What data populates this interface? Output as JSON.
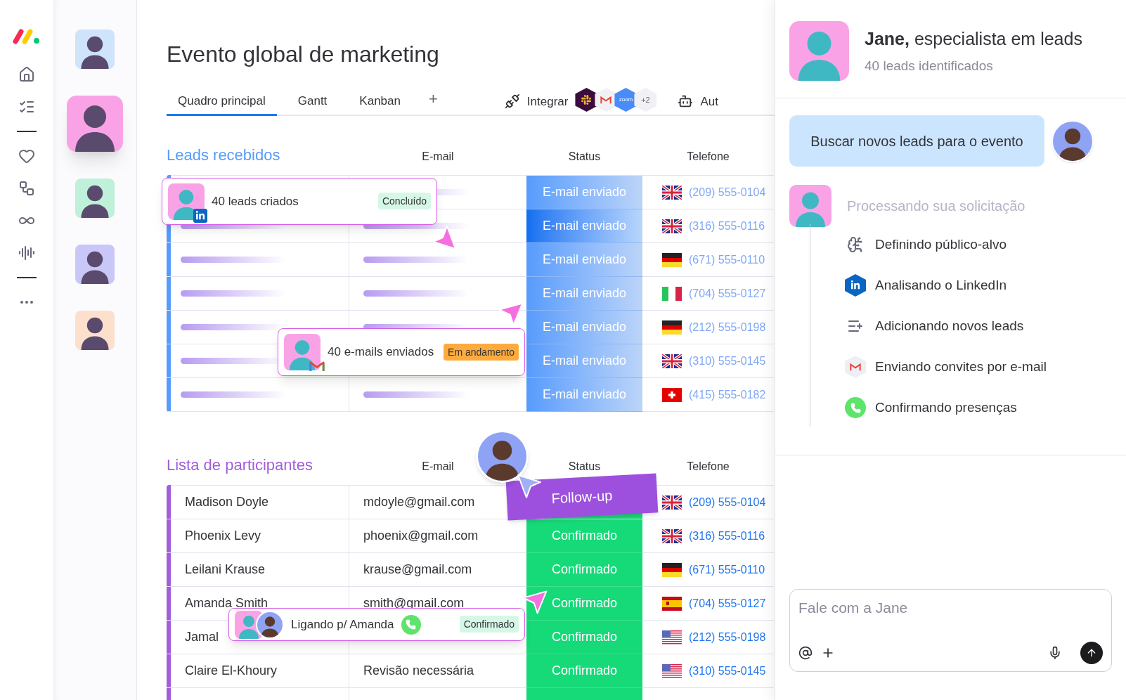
{
  "agents": [
    {
      "color": "#cfe3fb",
      "selected": false
    },
    {
      "color": "#f9a3e6",
      "selected": true
    },
    {
      "color": "#bff0d9",
      "selected": false
    },
    {
      "color": "#c9c7f7",
      "selected": false
    },
    {
      "color": "#fde0cc",
      "selected": false
    }
  ],
  "title": "Evento global de marketing",
  "tabs": [
    {
      "label": "Quadro principal",
      "selected": true
    },
    {
      "label": "Gantt",
      "selected": false
    },
    {
      "label": "Kanban",
      "selected": false
    }
  ],
  "add_tab": "+",
  "toolbar": {
    "integrate": "Integrar",
    "apps": [
      {
        "kind": "slack"
      },
      {
        "kind": "gmail"
      },
      {
        "kind": "zoom",
        "label": "zoom"
      },
      {
        "kind": "more",
        "label": "+2"
      }
    ],
    "automate": "Aut"
  },
  "leads": {
    "title": "Leads recebidos",
    "columns": [
      "E-mail",
      "Status",
      "Telefone"
    ],
    "rows": [
      {
        "status": "E-mail enviado",
        "selected": false,
        "flag": {
          "kind": "uk"
        },
        "phone": "(209) 555-0104"
      },
      {
        "status": "E-mail enviado",
        "selected": true,
        "flag": {
          "kind": "uk"
        },
        "phone": "(316) 555-0116"
      },
      {
        "status": "E-mail enviado",
        "selected": false,
        "flag": {
          "kind": "de"
        },
        "phone": "(671) 555-0110"
      },
      {
        "status": "E-mail enviado",
        "selected": false,
        "flag": {
          "kind": "it"
        },
        "phone": "(704) 555-0127"
      },
      {
        "status": "E-mail enviado",
        "selected": false,
        "flag": {
          "kind": "de"
        },
        "phone": "(212) 555-0198"
      },
      {
        "status": "E-mail enviado",
        "selected": false,
        "flag": {
          "kind": "uk"
        },
        "phone": "(310) 555-0145"
      },
      {
        "status": "E-mail enviado",
        "selected": false,
        "flag": {
          "kind": "ch"
        },
        "phone": "(415) 555-0182"
      }
    ]
  },
  "participants": {
    "title": "Lista de participantes",
    "columns": [
      "E-mail",
      "Status",
      "Telefone"
    ],
    "rows": [
      {
        "name": "Madison Doyle",
        "email": "mdoyle@gmail.com",
        "kind": "follow-up",
        "status": "Follow-up",
        "flag": {
          "kind": "uk"
        },
        "phone": "(209) 555-0104"
      },
      {
        "name": "Phoenix Levy",
        "email": "phoenix@gmail.com",
        "kind": "confirmed",
        "status": "Confirmado",
        "flag": {
          "kind": "uk"
        },
        "phone": "(316) 555-0116"
      },
      {
        "name": "Leilani Krause",
        "email": "krause@gmail.com",
        "kind": "confirmed",
        "status": "Confirmado",
        "flag": {
          "kind": "de"
        },
        "phone": "(671) 555-0110"
      },
      {
        "name": "Amanda Smith",
        "email": "smith@gmail.com",
        "kind": "confirmed",
        "status": "Confirmado",
        "flag": {
          "kind": "es"
        },
        "phone": "(704) 555-0127"
      },
      {
        "name": "Jamal",
        "kind": "confirmed",
        "status": "Confirmado",
        "flag": {
          "kind": "us"
        },
        "phone": "(212) 555-0198"
      },
      {
        "name": "Claire El-Khoury",
        "email": "Revisão necessária",
        "kind": "confirmed",
        "status": "Confirmado",
        "flag": {
          "kind": "us"
        },
        "phone": "(310) 555-0145"
      }
    ]
  },
  "activity_cards": [
    {
      "text": "40 leads criados",
      "badge": "Concluído",
      "kind": "done",
      "app": {
        "kind": "linkedin"
      }
    },
    {
      "text": "40 e-mails enviados",
      "badge": "Em andamento",
      "kind": "progress",
      "app": {
        "kind": "gmail"
      }
    },
    {
      "text": "Ligando p/ Amanda",
      "badge": "Confirmado",
      "kind": "done",
      "app": {
        "kind": "phone"
      }
    }
  ],
  "chat": {
    "heading": "**Jane,** especialista em leads",
    "subtitle": "40 leads identificados",
    "user_message": "Buscar novos leads para o evento",
    "status": "Processando sua solicitação",
    "steps": [
      {
        "kind": "brain",
        "text": "Definindo público-alvo"
      },
      {
        "kind": "linkedin",
        "text": "Analisando o LinkedIn"
      },
      {
        "kind": "list",
        "text": "Adicionando novos leads"
      },
      {
        "kind": "gmail",
        "text": "Enviando convites por e-mail"
      },
      {
        "kind": "phone",
        "text": "Confirmando presenças"
      }
    ],
    "composer": {
      "placeholder": "Fale com a Jane"
    }
  }
}
